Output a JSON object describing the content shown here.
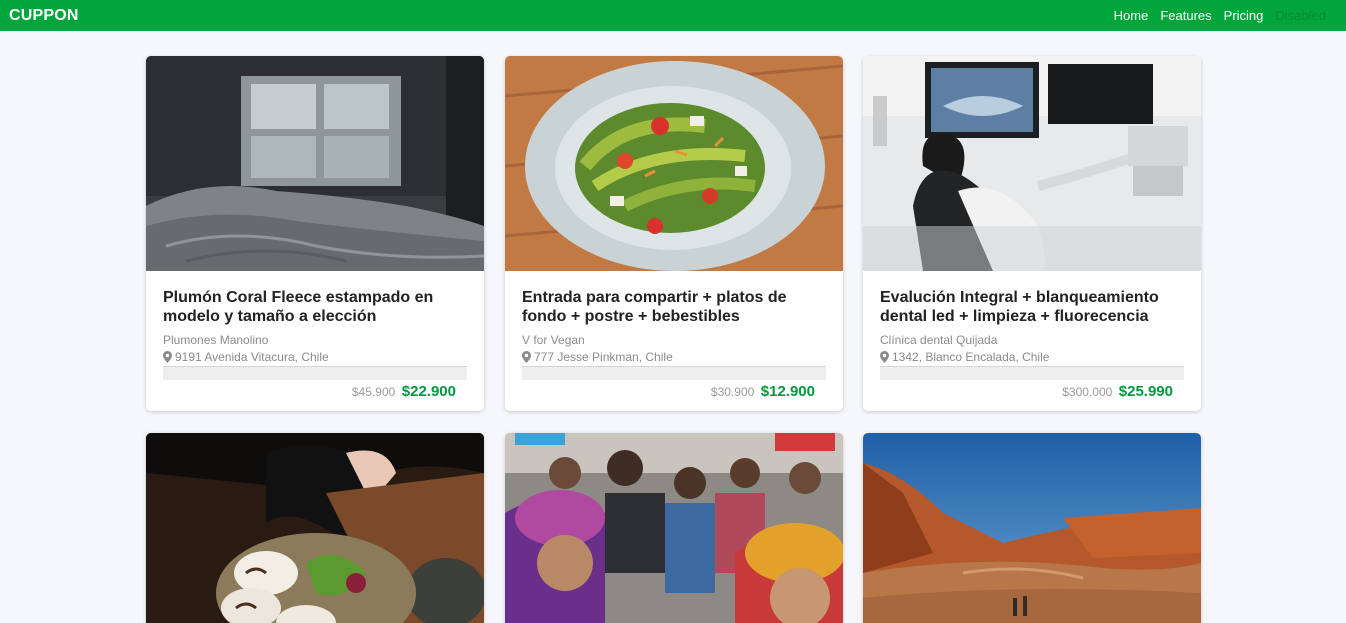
{
  "nav": {
    "brand": "CUPPON",
    "links": [
      {
        "label": "Home",
        "disabled": false
      },
      {
        "label": "Features",
        "disabled": false
      },
      {
        "label": "Pricing",
        "disabled": false
      },
      {
        "label": "Disabled",
        "disabled": true
      }
    ]
  },
  "colors": {
    "brand_green": "#00a63c",
    "price_green": "#009a3d"
  },
  "cards": [
    {
      "image": "bedroom-blanket-window-photo",
      "title": "Plumón Coral Fleece estampado en modelo y tamaño a elección",
      "merchant": "Plumones Manolino",
      "location": "9191 Avenida Vitacura, Chile",
      "old_price": "$45.900",
      "new_price": "$22.900"
    },
    {
      "image": "avocado-salad-plate-photo",
      "title": "Entrada para compartir + platos de fondo + postre + bebestibles",
      "merchant": "V for Vegan",
      "location": "777 Jesse Pinkman, Chile",
      "old_price": "$30.900",
      "new_price": "$12.900"
    },
    {
      "image": "dental-clinic-chair-photo",
      "title": "Evalución Integral + blanqueamiento dental led + limpieza + fluorecencia",
      "merchant": "Clínica dental Quijada",
      "location": "1342, Blanco Encalada, Chile",
      "old_price": "$300.000",
      "new_price": "$25.990"
    },
    {
      "image": "bao-buns-dinner-photo"
    },
    {
      "image": "festival-dancers-crowd-photo"
    },
    {
      "image": "desert-valley-canyon-photo"
    }
  ]
}
